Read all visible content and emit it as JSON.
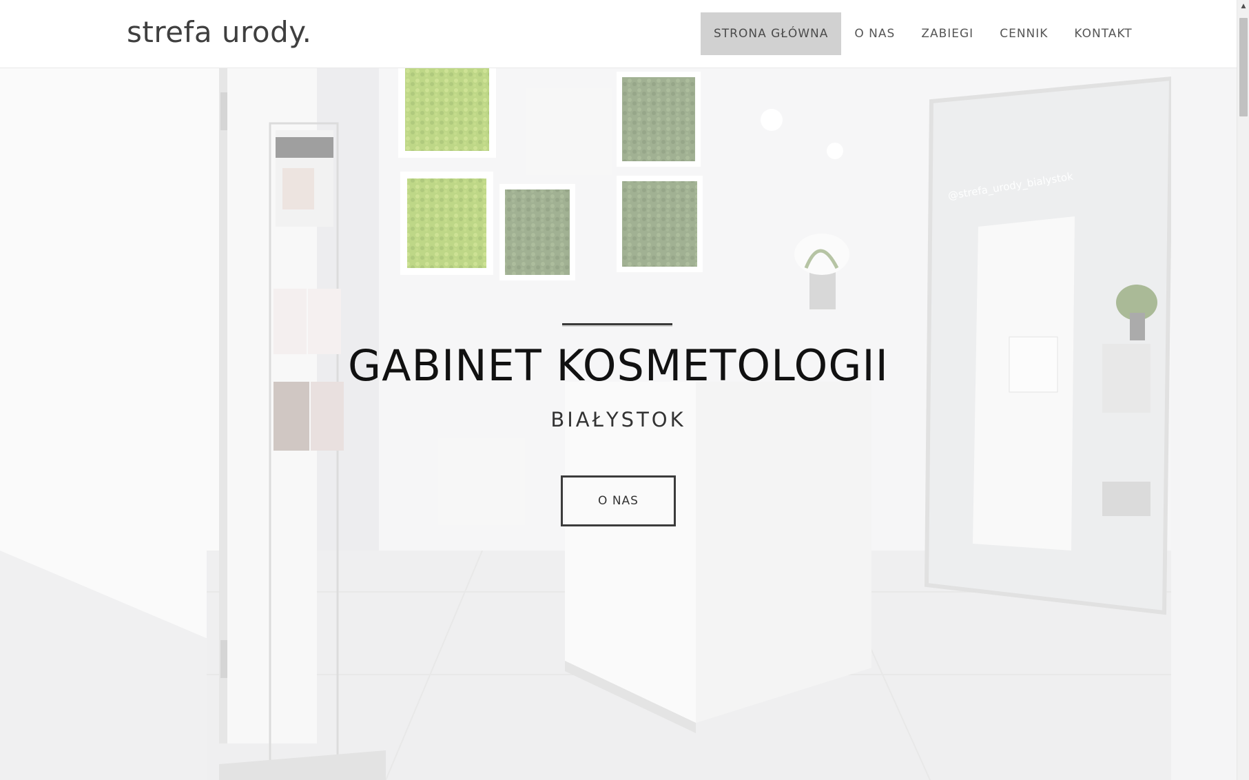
{
  "header": {
    "logo": "strefa urody.",
    "nav": [
      {
        "label": "STRONA GŁÓWNA",
        "active": true
      },
      {
        "label": "O NAS",
        "active": false
      },
      {
        "label": "ZABIEGI",
        "active": false
      },
      {
        "label": "CENNIK",
        "active": false
      },
      {
        "label": "KONTAKT",
        "active": false
      }
    ]
  },
  "hero": {
    "title": "GABINET KOSMETOLOGII",
    "subtitle": "BIAŁYSTOK",
    "button_label": "O NAS",
    "watermark": "@strefa_urody_bialystok"
  },
  "colors": {
    "nav_active_bg": "#d1d1d1",
    "text_dark": "#111111",
    "moss_light": "#9cc247",
    "moss_dark": "#6f8759"
  },
  "scrollbar": {
    "up_icon": "arrow-up-icon"
  }
}
